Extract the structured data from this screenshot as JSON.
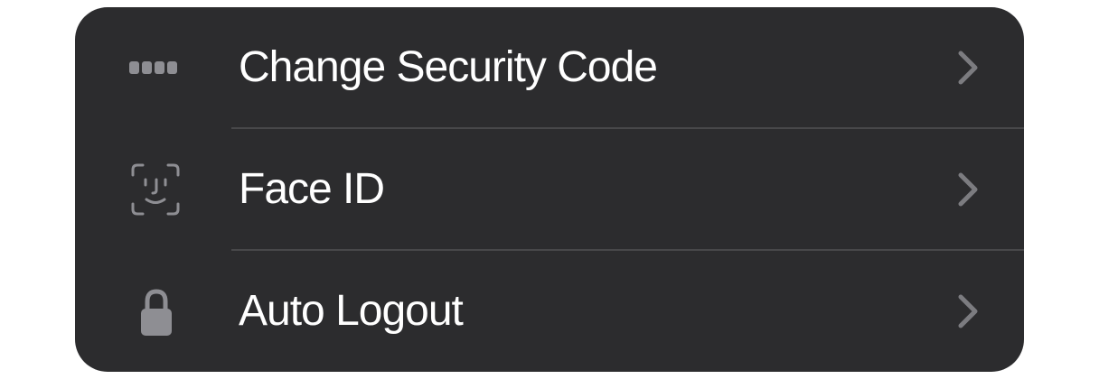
{
  "settings_list": {
    "items": [
      {
        "label": "Change Security Code",
        "icon": "passcode-dots-icon"
      },
      {
        "label": "Face ID",
        "icon": "face-id-icon"
      },
      {
        "label": "Auto Logout",
        "icon": "lock-icon"
      }
    ]
  },
  "colors": {
    "card_background": "#2c2c2e",
    "label_text": "#ffffff",
    "icon_gray": "#8e8e93",
    "chevron_gray": "#7c7c80",
    "divider": "#48484a"
  }
}
